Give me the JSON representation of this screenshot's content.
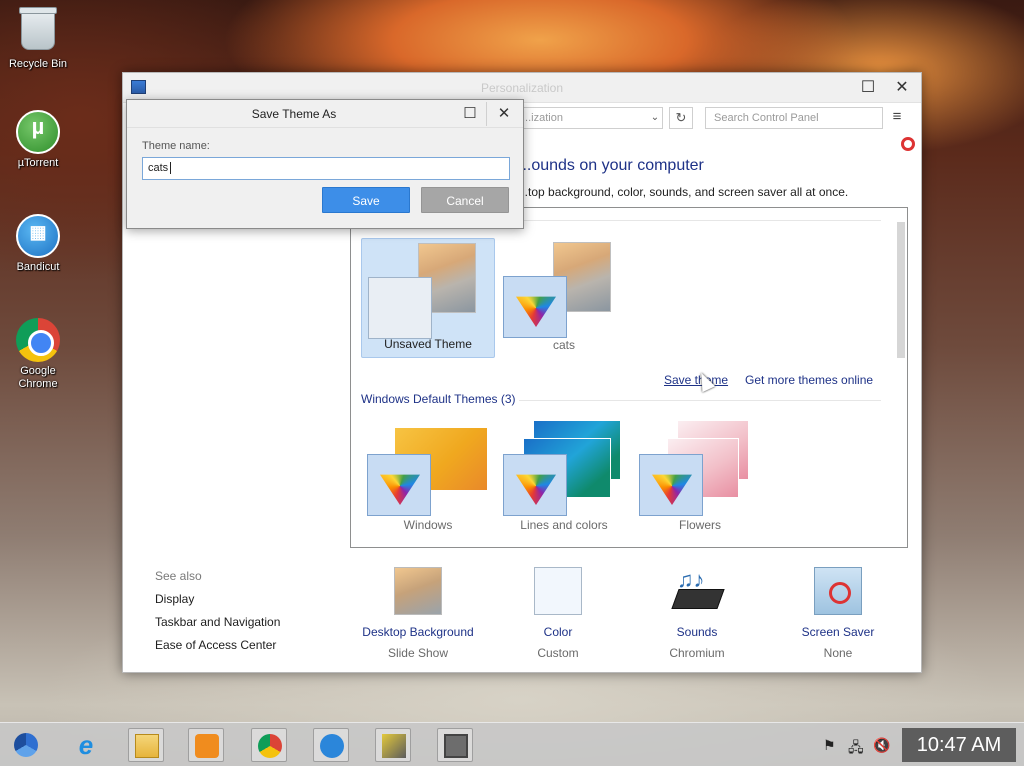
{
  "desktop": {
    "icons": [
      {
        "label": "Recycle Bin",
        "icon": "recycle-bin-icon"
      },
      {
        "label": "µTorrent",
        "icon": "utorrent-icon",
        "glyph": "µ"
      },
      {
        "label": "Bandicut",
        "icon": "bandicut-icon",
        "glyph": "▦"
      },
      {
        "label": "Google Chrome",
        "icon": "chrome-icon"
      }
    ]
  },
  "window": {
    "title": "Personalization",
    "controls": {
      "maximize": "☐",
      "close": "✕"
    },
    "address": {
      "text": "...ization",
      "dropdown": "⌄",
      "refresh": "↻"
    },
    "search": {
      "placeholder": "Search Control Panel"
    },
    "menu_icon": "≡",
    "heading": "...ounds on your computer",
    "subheading": "...top background, color, sounds, and screen saver all at once.",
    "my_themes": [
      {
        "label": "Unsaved Theme",
        "selected": true
      },
      {
        "label": "cats",
        "selected": false
      }
    ],
    "links": {
      "save_theme": "Save theme",
      "get_more": "Get more themes online"
    },
    "default_group_title": "Windows Default Themes (3)",
    "default_themes": [
      {
        "label": "Windows"
      },
      {
        "label": "Lines and colors"
      },
      {
        "label": "Flowers"
      }
    ],
    "see_also": {
      "title": "See also",
      "items": [
        "Display",
        "Taskbar and Navigation",
        "Ease of Access Center"
      ]
    },
    "bottom_items": [
      {
        "title": "Desktop Background",
        "sub": "Slide Show"
      },
      {
        "title": "Color",
        "sub": "Custom"
      },
      {
        "title": "Sounds",
        "sub": "Chromium"
      },
      {
        "title": "Screen Saver",
        "sub": "None"
      }
    ]
  },
  "dialog": {
    "title": "Save Theme As",
    "controls": {
      "maximize": "☐",
      "close": "✕"
    },
    "field_label": "Theme name:",
    "field_value": "cats",
    "save_label": "Save",
    "cancel_label": "Cancel"
  },
  "taskbar": {
    "apps": [
      "chromium-icon",
      "internet-explorer-icon",
      "file-explorer-icon",
      "media-player-icon",
      "chrome-icon",
      "bandicut-icon",
      "bandicam-icon",
      "window-manager-icon"
    ],
    "tray": {
      "flag": "⚑",
      "network": "🖧",
      "volume": "🔇"
    },
    "clock": "10:47 AM"
  }
}
